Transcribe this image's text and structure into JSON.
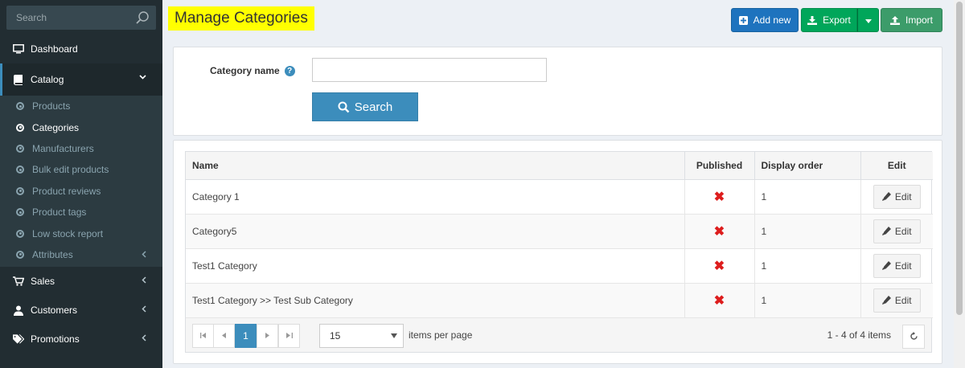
{
  "sidebar": {
    "search_placeholder": "Search",
    "items": [
      {
        "label": "Dashboard"
      },
      {
        "label": "Catalog"
      },
      {
        "label": "Sales"
      },
      {
        "label": "Customers"
      },
      {
        "label": "Promotions"
      }
    ],
    "catalog_children": [
      {
        "label": "Products"
      },
      {
        "label": "Categories"
      },
      {
        "label": "Manufacturers"
      },
      {
        "label": "Bulk edit products"
      },
      {
        "label": "Product reviews"
      },
      {
        "label": "Product tags"
      },
      {
        "label": "Low stock report"
      },
      {
        "label": "Attributes"
      }
    ],
    "active_item": "Catalog",
    "active_child": "Categories"
  },
  "header": {
    "title": "Manage Categories",
    "add_label": "Add new",
    "export_label": "Export",
    "import_label": "Import"
  },
  "search": {
    "field_label": "Category name",
    "field_value": "",
    "button_label": "Search"
  },
  "grid": {
    "columns": [
      "Name",
      "Published",
      "Display order",
      "Edit"
    ],
    "rows": [
      {
        "name": "Category 1",
        "published": false,
        "display_order": "1",
        "edit": "Edit"
      },
      {
        "name": "Category5",
        "published": false,
        "display_order": "1",
        "edit": "Edit"
      },
      {
        "name": "Test1 Category",
        "published": false,
        "display_order": "1",
        "edit": "Edit"
      },
      {
        "name": "Test1 Category >> Test Sub Category",
        "published": false,
        "display_order": "1",
        "edit": "Edit"
      }
    ],
    "pager": {
      "current_page": "1",
      "page_size": "15",
      "page_size_label": "items per page",
      "info": "1 - 4 of 4 items"
    }
  },
  "colors": {
    "sidebar_bg": "#222d32",
    "accent": "#3c8dbc",
    "add_btn": "#1e73be",
    "export_btn": "#00a65a",
    "import_btn": "#3c9c6a",
    "unpublished_mark": "#dd1d1d",
    "title_highlight": "#ffff00"
  }
}
